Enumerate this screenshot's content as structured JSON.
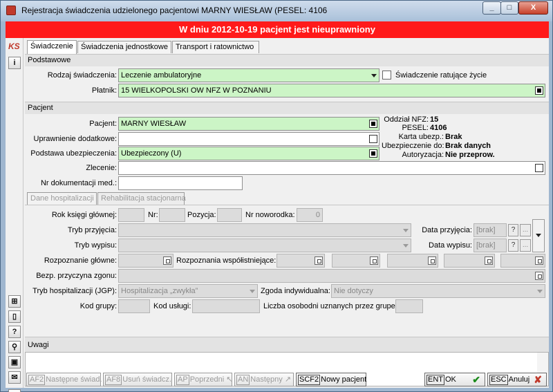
{
  "window": {
    "title": "Rejestracja świadczenia udzielonego pacjentowi MARNY WIESŁAW (PESEL: 4106",
    "minimize": "_",
    "maximize": "□",
    "close": "X"
  },
  "banner": "W dniu 2012-10-19 pacjent jest nieuprawniony",
  "logo_text": "KS",
  "tabs": [
    "Świadczenie",
    "Świadczenia jednostkowe",
    "Transport i ratownictwo"
  ],
  "podstawowe": {
    "header": "Podstawowe",
    "rodzaj_label": "Rodzaj świadczenia:",
    "rodzaj_value": "Leczenie ambulatoryjne",
    "ratujace_label": "Świadczenie ratujące życie",
    "platnik_label": "Płatnik:",
    "platnik_value": "15 WIELKOPOLSKI OW NFZ W POZNANIU"
  },
  "pacjent": {
    "header": "Pacjent",
    "pacjent_label": "Pacjent:",
    "pacjent_value": "MARNY WIESŁAW",
    "uprawnienie_label": "Uprawnienie dodatkowe:",
    "uprawnienie_value": "",
    "podstawa_label": "Podstawa ubezpieczenia:",
    "podstawa_value": "Ubezpieczony (U)",
    "zlecenie_label": "Zlecenie:",
    "zlecenie_value": "",
    "nr_dok_label": "Nr dokumentacji med.:",
    "nr_dok_value": "",
    "info": [
      {
        "label": "Oddział NFZ:",
        "value": "15"
      },
      {
        "label": "PESEL:",
        "value": "4106"
      },
      {
        "label": "Karta ubezp.:",
        "value": "Brak"
      },
      {
        "label": "Ubezpieczenie do:",
        "value": "Brak danych"
      },
      {
        "label": "Autoryzacja:",
        "value": "Nie przeprow."
      }
    ]
  },
  "hosp": {
    "tabs": [
      "Dane hospitalizacji",
      "Rehabilitacja stacjonarna"
    ],
    "rok_label": "Rok księgi głównej:",
    "nr_label": "Nr:",
    "pozycja_label": "Pozycja:",
    "noworodka_label": "Nr noworodka:",
    "noworodka_value": "0",
    "tryb_przyjecia_label": "Tryb przyjęcia:",
    "data_przyjecia_label": "Data przyjęcia:",
    "data_przyjecia_value": "[brak]",
    "tryb_wypisu_label": "Tryb wypisu:",
    "data_wypisu_label": "Data wypisu:",
    "data_wypisu_value": "[brak]",
    "q_label": "?",
    "dots_label": "...",
    "rozp_glowne_label": "Rozpoznanie główne:",
    "rozp_wsp_label": "Rozpoznania współistniejące:",
    "przyczyna_label": "Bezp. przyczyna zgonu:",
    "tryb_jgp_label": "Tryb hospitalizacji (JGP):",
    "tryb_jgp_value": "Hospitalizacja „zwykła”",
    "zgoda_label": "Zgoda indywidualna:",
    "zgoda_value": "Nie dotyczy",
    "kod_grupy_label": "Kod grupy:",
    "kod_uslugi_label": "Kod usługi:",
    "liczba_label": "Liczba osobodni uznanych przez gruper:"
  },
  "uwagi": {
    "header": "Uwagi",
    "value": ""
  },
  "left_buttons": [
    "i",
    "⊞",
    "▯",
    "?",
    "⚲",
    "▣",
    "✉",
    "✕"
  ],
  "footer": {
    "nastepne_key": "AF2",
    "nastepne_label": "Następne świad.",
    "usun_key": "AF8",
    "usun_label": "Usuń świadcz.",
    "poprzedni_key": "AP",
    "poprzedni_label": "Poprzedni",
    "nastepny_key": "AN",
    "nastepny_label": "Następny",
    "nowy_key": "SCF2",
    "nowy_label": "Nowy pacjent",
    "ok_key": "ENT",
    "ok_label": "OK",
    "anuluj_key": "ESC",
    "anuluj_label": "Anuluj"
  }
}
